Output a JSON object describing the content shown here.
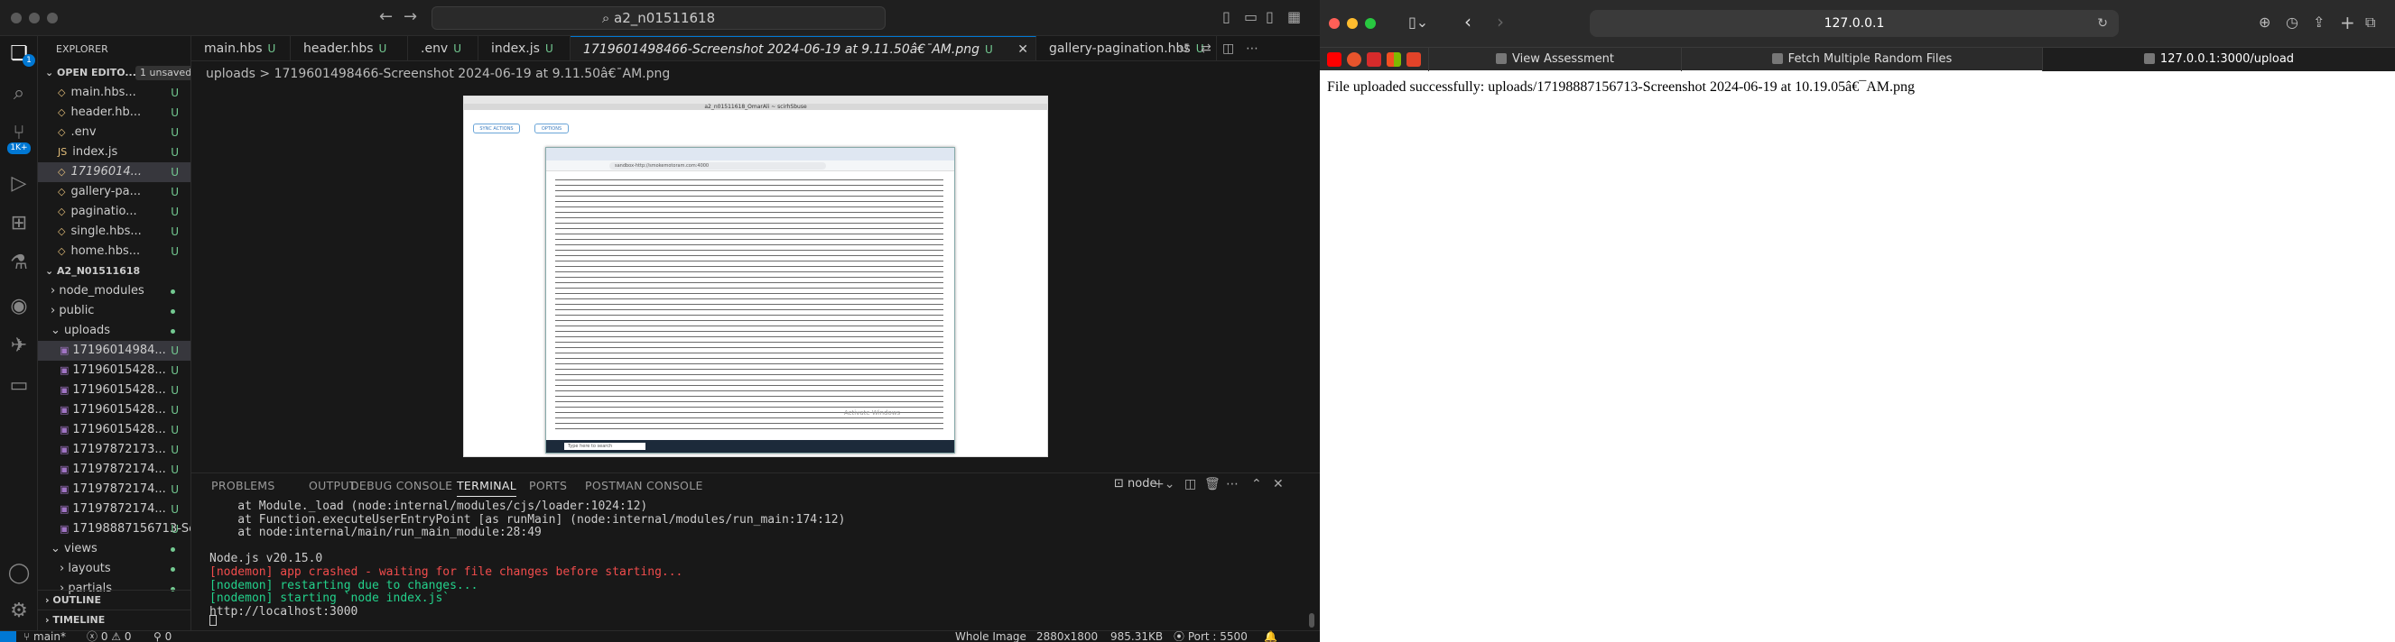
{
  "vscode": {
    "command_center": "a2_n01511618",
    "explorer_title": "EXPLORER",
    "open_editors": {
      "label": "OPEN EDITO...",
      "badge": "1 unsaved"
    },
    "open_files": [
      {
        "name": "main.hbs...",
        "status": "U"
      },
      {
        "name": "header.hb...",
        "status": "U"
      },
      {
        "name": ".env",
        "status": "U"
      },
      {
        "name": "index.js",
        "status": "U"
      },
      {
        "name": "17196014...",
        "status": "U"
      },
      {
        "name": "gallery-pa...",
        "status": "U"
      },
      {
        "name": "paginatio...",
        "status": "U"
      },
      {
        "name": "single.hbs...",
        "status": "U"
      },
      {
        "name": "home.hbs...",
        "status": "U"
      }
    ],
    "project": "A2_N01511618",
    "tree": [
      {
        "name": "node_modules",
        "type": "folder"
      },
      {
        "name": "public",
        "type": "folder"
      },
      {
        "name": "uploads",
        "type": "folder-open"
      }
    ],
    "uploads": [
      "17196014984...",
      "17196015428...",
      "17196015428...",
      "17196015428...",
      "17196015428...",
      "17197872173...",
      "17197872174...",
      "17197872174...",
      "17197872174...",
      "17198887156713-Sc..."
    ],
    "upload_status": "U",
    "tree2": [
      {
        "name": "views",
        "type": "folder-open"
      },
      {
        "name": "layouts",
        "type": "folder"
      },
      {
        "name": "partials",
        "type": "folder"
      }
    ],
    "outline": "OUTLINE",
    "timeline": "TIMELINE",
    "tabs": [
      {
        "label": "main.hbs",
        "status": "U"
      },
      {
        "label": "header.hbs",
        "status": "U"
      },
      {
        "label": ".env",
        "status": "U"
      },
      {
        "label": "index.js",
        "status": "U"
      },
      {
        "label": "17196014984​66-Screenshot 2024-06-19 at 9.11.50â€¯AM.png",
        "status": "U"
      },
      {
        "label": "gallery-pagination.hbs",
        "status": "U"
      }
    ],
    "breadcrumb": "uploads > 1719601498466-Screenshot 2024-06-19 at 9.11.50â€¯AM.png",
    "preview": {
      "chrome_title": "a2_n01511618_OmarAli ~ scirhSbuse",
      "btn1": "SYNC ACTIONS",
      "btn2": "OPTIONS",
      "address": "sandbox-http://smokemotoram.com:4000",
      "watermark": "Activate Windows",
      "search": "Type here to search"
    },
    "panel_tabs": [
      "PROBLEMS",
      "OUTPUT",
      "DEBUG CONSOLE",
      "TERMINAL",
      "PORTS",
      "POSTMAN CONSOLE"
    ],
    "terminal_name": "node",
    "terminal_lines": [
      {
        "text": "    at Module._load (node:internal/modules/cjs/loader:1024:12)",
        "color": "#cccccc"
      },
      {
        "text": "    at Function.executeUserEntryPoint [as runMain] (node:internal/modules/run_main:174:12)",
        "color": "#cccccc"
      },
      {
        "text": "    at node:internal/main/run_main_module:28:49",
        "color": "#cccccc"
      },
      {
        "text": "",
        "color": "#cccccc"
      },
      {
        "text": "Node.js v20.15.0",
        "color": "#cccccc"
      },
      {
        "text": "[nodemon] app crashed - waiting for file changes before starting...",
        "color": "#f14c4c"
      },
      {
        "text": "[nodemon] restarting due to changes...",
        "color": "#23d18b"
      },
      {
        "text": "[nodemon] starting `node index.js`",
        "color": "#23d18b"
      },
      {
        "text": "http://localhost:3000",
        "color": "#cccccc"
      }
    ],
    "status": {
      "branch": "main*",
      "problems": "0 ⚠ 0",
      "warnings": "0",
      "image_kind": "Whole Image",
      "dimensions": "2880x1800",
      "size": "985.31KB",
      "port": "Port : 5500"
    }
  },
  "safari": {
    "url": "127.0.0.1",
    "bookmarks": [
      {
        "label": "View Assessment"
      },
      {
        "label": "Fetch Multiple Random Files"
      },
      {
        "label": "127.0.0.1:3000/upload"
      }
    ],
    "message": "File uploaded successfully: uploads/17198887156713-Screenshot 2024-06-19 at 10.19.05â€¯AM.png"
  },
  "colors": {
    "accent": "#0078d4",
    "untracked": "#73c991",
    "error": "#f14c4c",
    "success": "#23d18b"
  }
}
